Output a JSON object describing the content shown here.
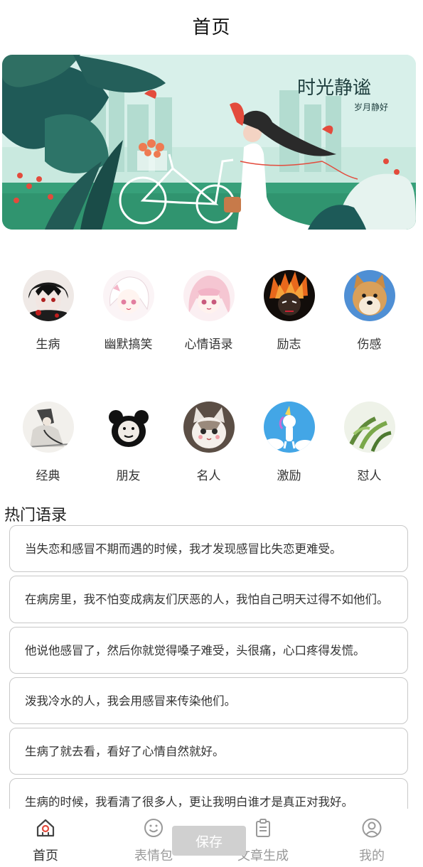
{
  "header": {
    "title": "首页"
  },
  "banner": {
    "calligraphy": "时光静谧",
    "subtitle": "岁月静好"
  },
  "categories_row1": [
    {
      "label": "生病",
      "avatar": "dark-hair-boy-avatar"
    },
    {
      "label": "幽默搞笑",
      "avatar": "white-hair-girl-avatar"
    },
    {
      "label": "心情语录",
      "avatar": "pink-hair-girl-avatar"
    },
    {
      "label": "励志",
      "avatar": "flame-hair-avatar"
    },
    {
      "label": "伤感",
      "avatar": "shiba-dog-avatar"
    }
  ],
  "categories_row2": [
    {
      "label": "经典",
      "avatar": "ink-painting-avatar"
    },
    {
      "label": "朋友",
      "avatar": "panda-meme-avatar"
    },
    {
      "label": "名人",
      "avatar": "cat-avatar"
    },
    {
      "label": "激励",
      "avatar": "unicorn-avatar"
    },
    {
      "label": "怼人",
      "avatar": "green-leaves-avatar"
    }
  ],
  "hot": {
    "title": "热门语录",
    "quotes": [
      "当失恋和感冒不期而遇的时候，我才发现感冒比失恋更难受。",
      "在病房里，我不怕变成病友们厌恶的人，我怕自己明天过得不如他们。",
      "他说他感冒了，然后你就觉得嗓子难受，头很痛，心口疼得发慌。",
      "泼我冷水的人，我会用感冒来传染他们。",
      "生病了就去看，看好了心情自然就好。",
      "生病的时候，我看清了很多人，更让我明白谁才是真正对我好。"
    ]
  },
  "tabbar": {
    "tabs": [
      {
        "label": "首页",
        "icon": "home-icon",
        "active": true
      },
      {
        "label": "表情包",
        "icon": "smile-icon",
        "active": false
      },
      {
        "label": "文章生成",
        "icon": "clipboard-icon",
        "active": false
      },
      {
        "label": "我的",
        "icon": "user-icon",
        "active": false
      }
    ],
    "save_label": "保存"
  },
  "colors": {
    "accent": "#e34b3c",
    "banner_bg": "#bfe3d8",
    "tab_inactive": "#999999"
  }
}
